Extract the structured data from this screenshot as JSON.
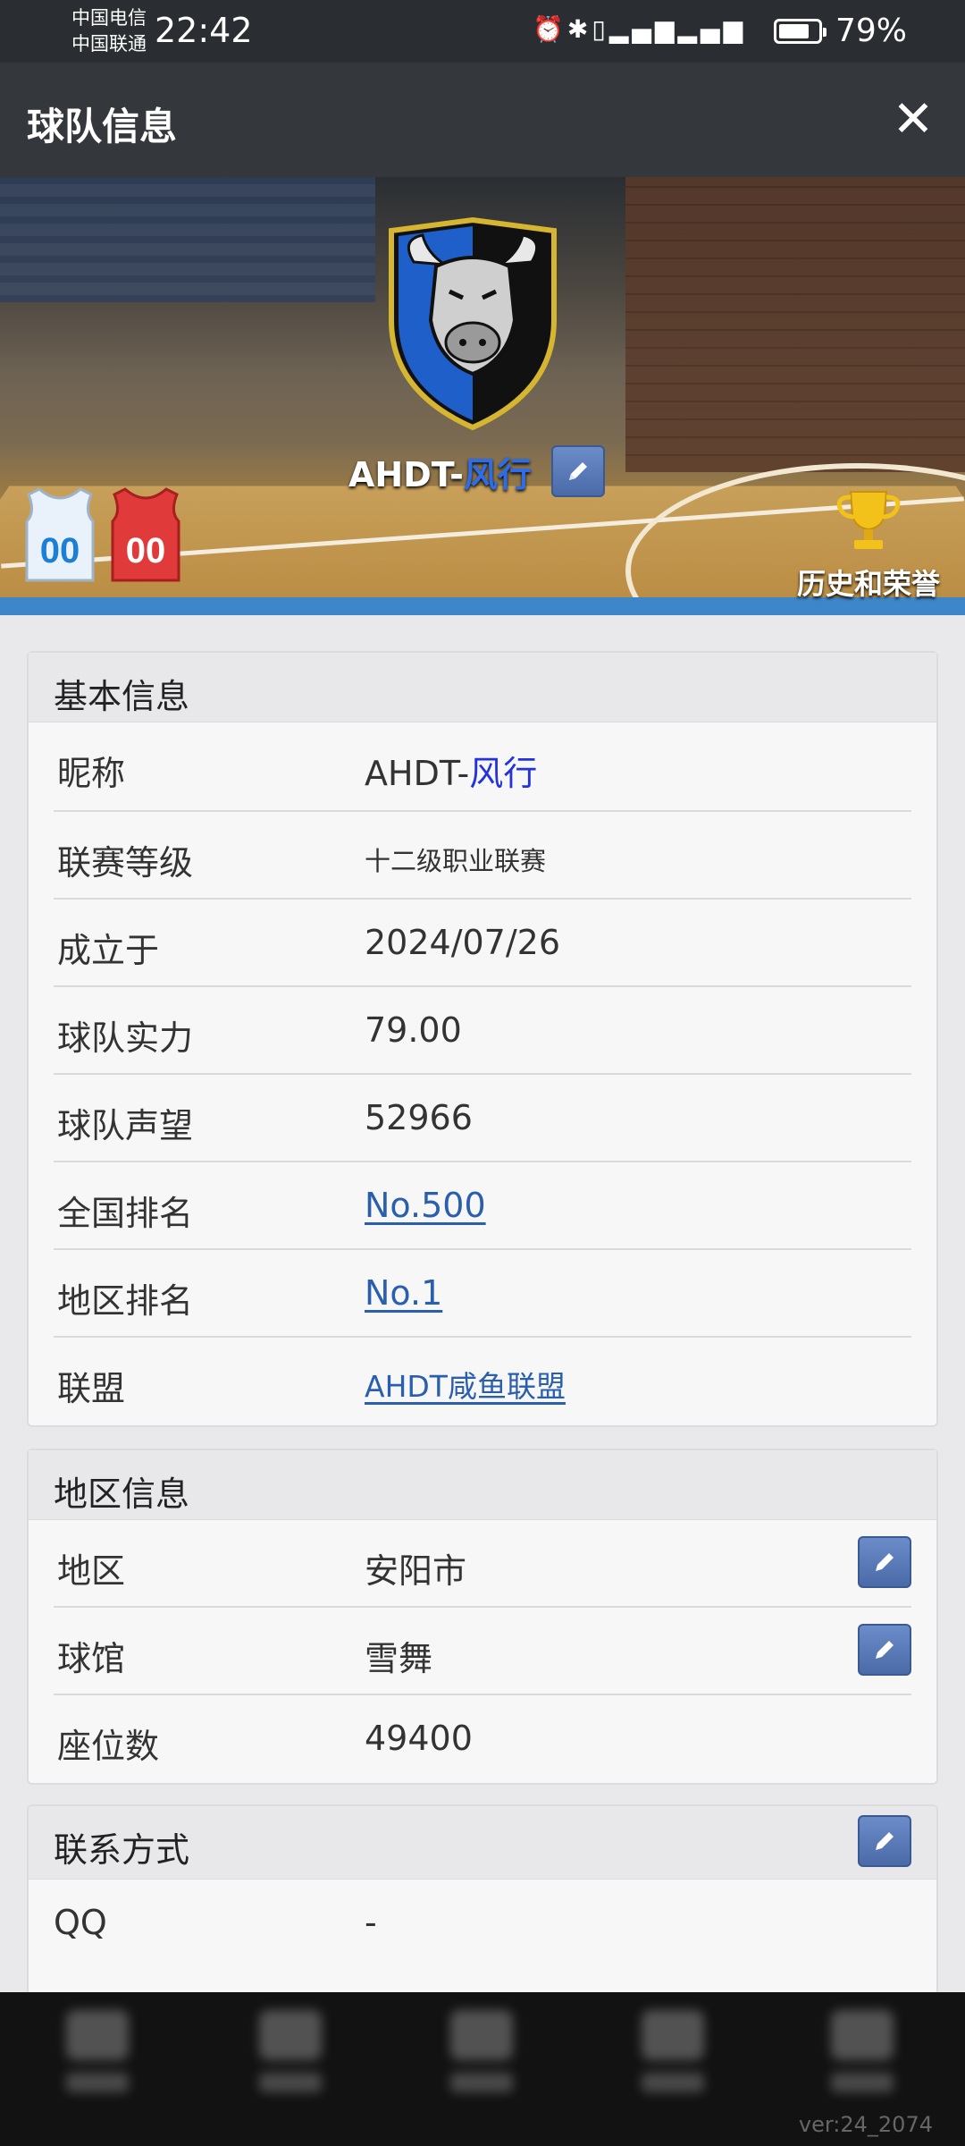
{
  "status_bar": {
    "carrier_1": "中国电信",
    "carrier_2": "中国联通",
    "time": "22:42",
    "icons": [
      "alarm-icon",
      "bluetooth-icon",
      "vibrate-icon",
      "4g-signal-icon",
      "4g-signal-icon"
    ],
    "battery_percent": "79%",
    "battery_level": 0.79
  },
  "app_bar": {
    "title": "球队信息",
    "close_icon": "close-icon"
  },
  "hero": {
    "team_name_prefix": "AHDT-",
    "team_name_highlight": "风行",
    "jersey_home_number": "00",
    "jersey_away_number": "00",
    "honors_label": "历史和荣誉",
    "colors": {
      "emblem_blue": "#1f5fc9",
      "emblem_black": "#111111",
      "emblem_gold": "#d6b530"
    }
  },
  "basic_info": {
    "title": "基本信息",
    "rows": [
      {
        "label": "昵称",
        "value_prefix": "AHDT-",
        "value_highlight": "风行"
      },
      {
        "label": "联赛等级",
        "value": "十二级职业联赛"
      },
      {
        "label": "成立于",
        "value": "2024/07/26"
      },
      {
        "label": "球队实力",
        "value": "79.00"
      },
      {
        "label": "球队声望",
        "value": "52966"
      },
      {
        "label": "全国排名",
        "value": "No.500"
      },
      {
        "label": "地区排名",
        "value": "No.1"
      },
      {
        "label": "联盟",
        "value": "AHDT咸鱼联盟"
      }
    ]
  },
  "region_info": {
    "title": "地区信息",
    "rows": [
      {
        "label": "地区",
        "value": "安阳市"
      },
      {
        "label": "球馆",
        "value": "雪舞"
      },
      {
        "label": "座位数",
        "value": "49400"
      }
    ]
  },
  "contact_info": {
    "title": "联系方式",
    "rows": [
      {
        "label": "QQ",
        "value": "-"
      }
    ]
  },
  "footer": {
    "version": "ver:24_2074"
  }
}
